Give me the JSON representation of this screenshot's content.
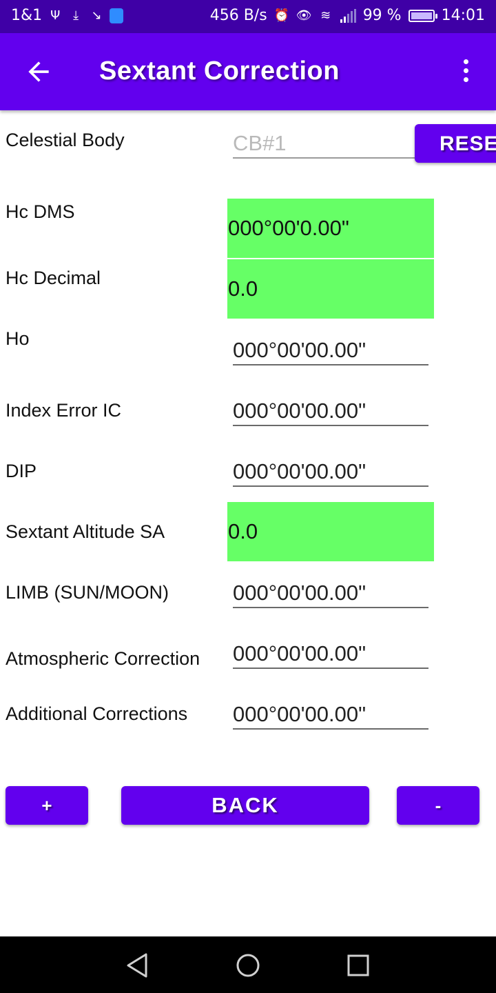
{
  "status_bar": {
    "carrier": "1&1",
    "speed": "456 B/s",
    "battery": "99 %",
    "time": "14:01",
    "icons_left": [
      "usb-icon",
      "download-icon",
      "missed-call-icon",
      "shield-icon"
    ],
    "icons_right": [
      "alarm-icon",
      "eye-icon",
      "wifi-icon",
      "signal-icon",
      "battery-icon"
    ]
  },
  "app_bar": {
    "title": "Sextant Correction",
    "back_icon": "arrow-left-icon",
    "menu_icon": "more-vert-icon"
  },
  "form": {
    "celestial_body": {
      "label": "Celestial Body",
      "placeholder": "CB#1"
    },
    "reset_label": "RESET",
    "hc_dms": {
      "label": "Hc DMS",
      "value": "000°00'0.00\""
    },
    "hc_decimal": {
      "label": "Hc Decimal",
      "value": "0.0"
    },
    "ho": {
      "label": "Ho",
      "value": "000°00'00.00\""
    },
    "index_error": {
      "label": "Index Error IC",
      "value": "000°00'00.00\""
    },
    "dip": {
      "label": "DIP",
      "value": "000°00'00.00\""
    },
    "sextant_altitude": {
      "label": "Sextant Altitude SA",
      "value": "0.0"
    },
    "limb": {
      "label": "LIMB (SUN/MOON)",
      "value": "000°00'00.00\""
    },
    "atmospheric": {
      "label": "Atmospheric Correction",
      "value": "000°00'00.00\""
    },
    "additional": {
      "label": "Additional Corrections",
      "value": "000°00'00.00\""
    }
  },
  "buttons": {
    "plus": "+",
    "back": "BACK",
    "minus": "-"
  },
  "colors": {
    "status_bar": "#3f00a6",
    "primary": "#6200ee",
    "result_bg": "#66ff66"
  }
}
